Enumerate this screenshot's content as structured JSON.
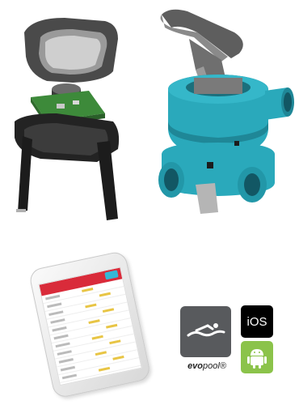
{
  "logos": {
    "evopool_prefix": "evo",
    "evopool_suffix": "pool®",
    "ios_label": "iOS"
  },
  "colors": {
    "valve_teal": "#2aa9bb",
    "handle_gray": "#7d7d7d",
    "pcb_green": "#3d8a3a",
    "evopool_gray": "#585a5d",
    "android_green": "#8bc34a",
    "app_red": "#d92b3a"
  }
}
